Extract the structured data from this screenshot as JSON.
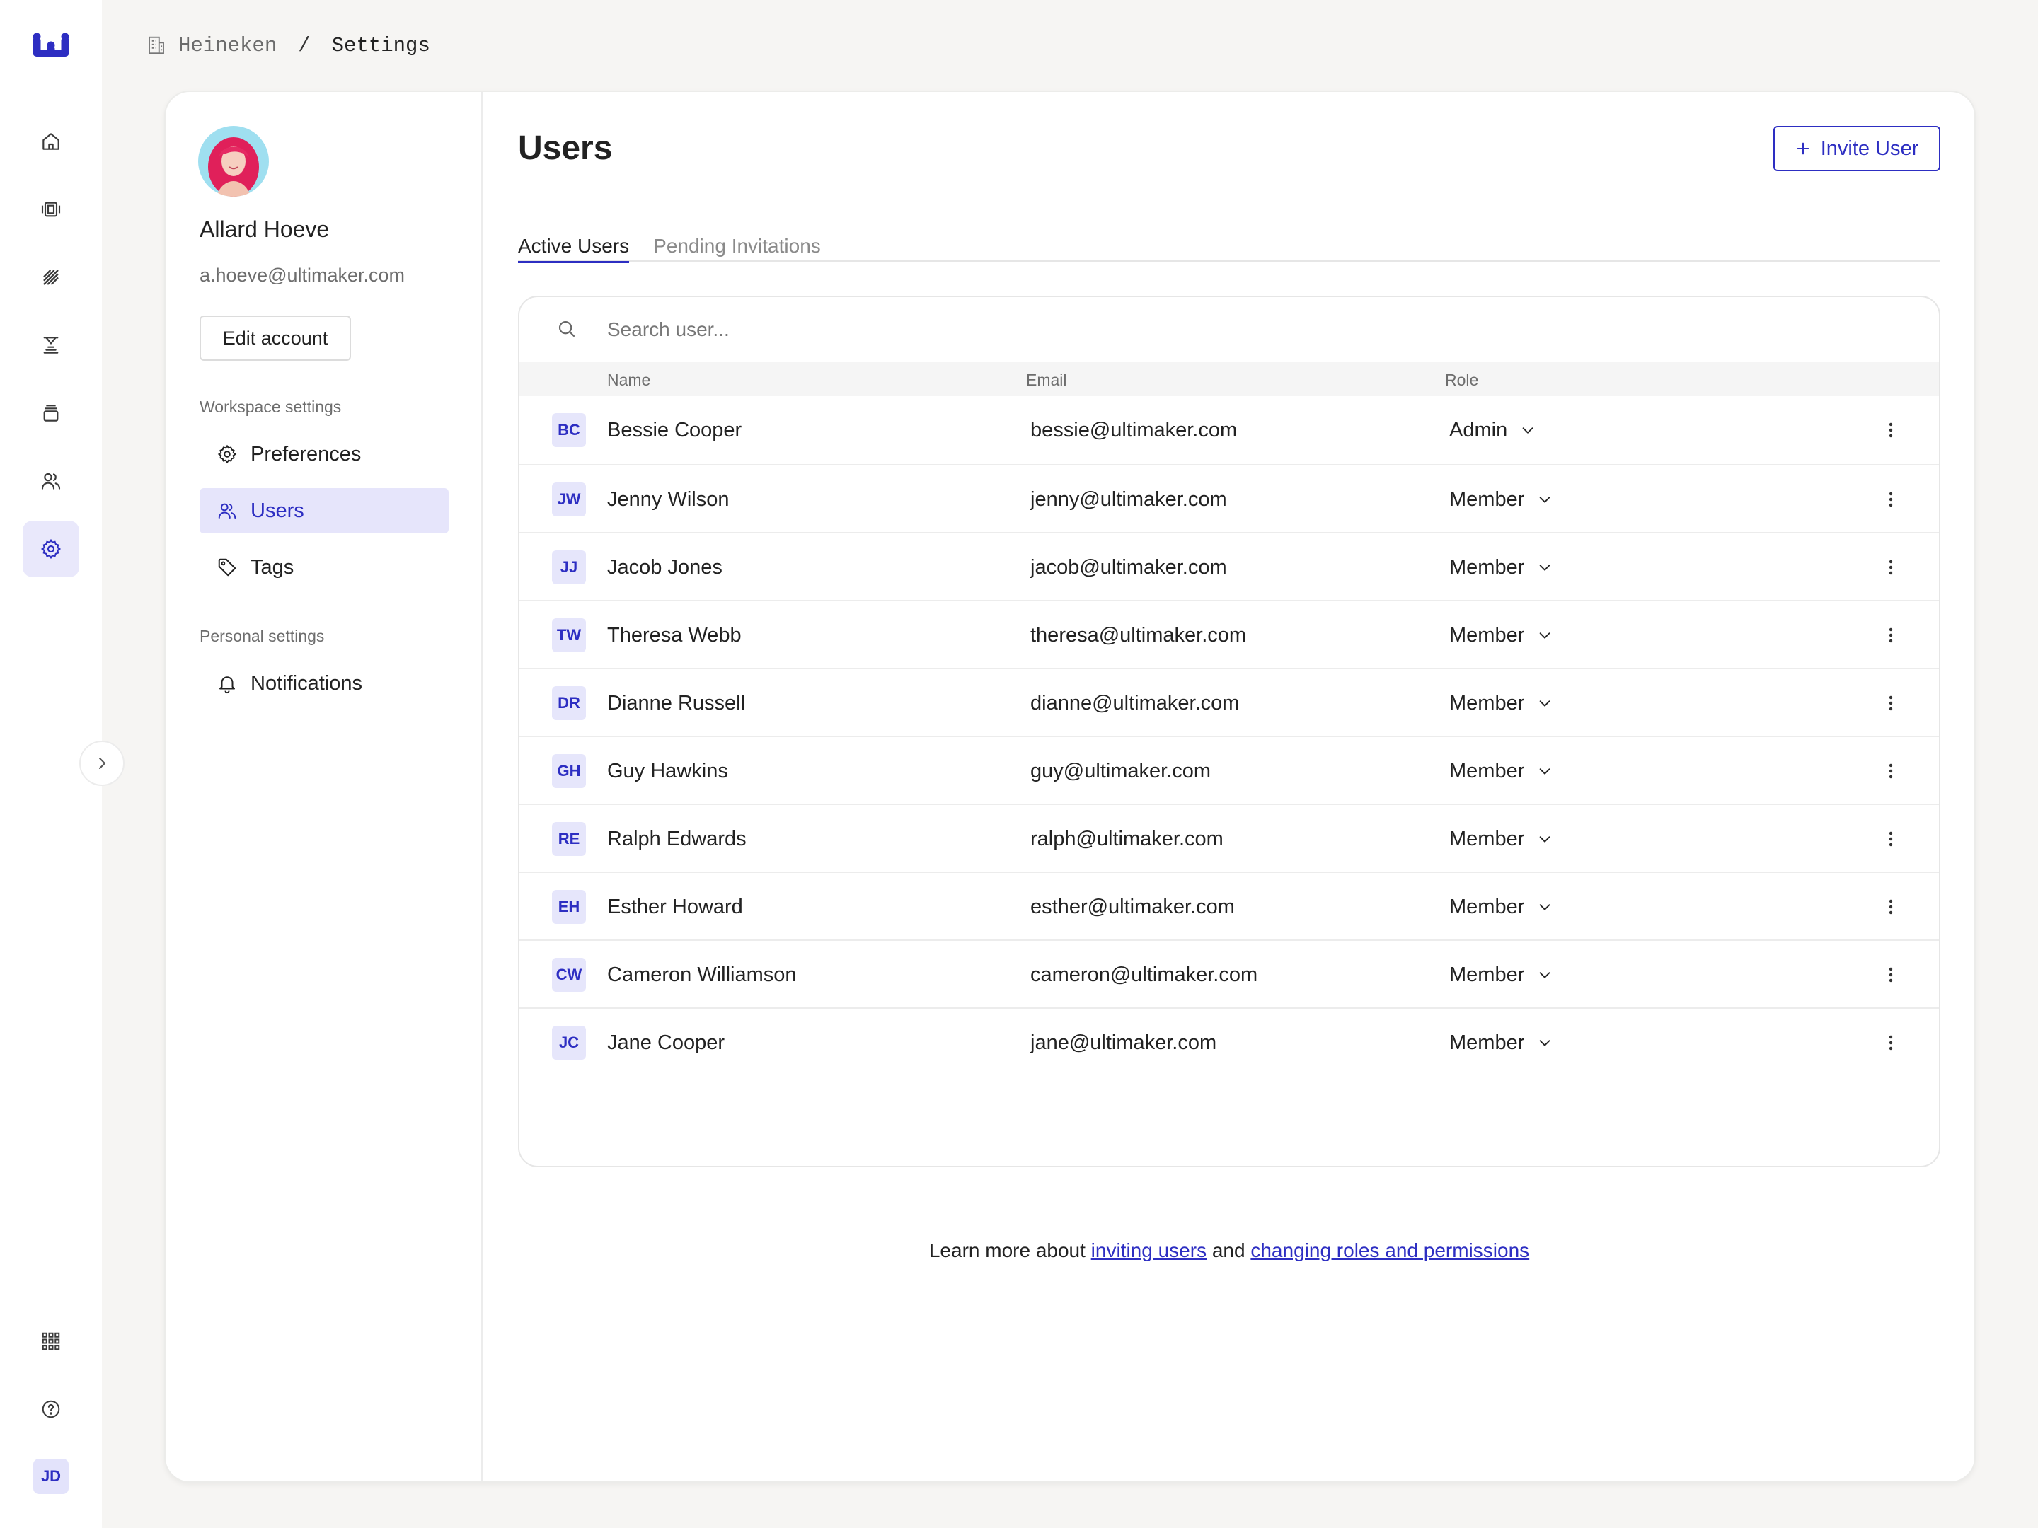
{
  "colors": {
    "accent": "#2d2ec2",
    "accent_soft": "#e6e5fb",
    "background": "#f6f5f3"
  },
  "rail": {
    "icons": [
      "home-icon",
      "layers-icon",
      "stripes-icon",
      "printer-icon",
      "library-icon",
      "people-icon",
      "gear-icon"
    ],
    "bottom_icons": [
      "apps-grid-icon",
      "help-icon"
    ],
    "avatar_initials": "JD"
  },
  "breadcrumb": {
    "org": "Heineken",
    "separator": "/",
    "current": "Settings"
  },
  "profile": {
    "name": "Allard Hoeve",
    "email": "a.hoeve@ultimaker.com",
    "edit_label": "Edit account"
  },
  "settings_nav": {
    "workspace_label": "Workspace settings",
    "workspace_items": [
      {
        "label": "Preferences",
        "icon": "gear-icon"
      },
      {
        "label": "Users",
        "icon": "users-icon"
      },
      {
        "label": "Tags",
        "icon": "tag-icon"
      }
    ],
    "personal_label": "Personal settings",
    "personal_items": [
      {
        "label": "Notifications",
        "icon": "bell-icon"
      }
    ]
  },
  "main": {
    "title": "Users",
    "invite_label": "Invite User",
    "tabs": [
      {
        "label": "Active Users"
      },
      {
        "label": "Pending Invitations"
      }
    ],
    "search": {
      "placeholder": "Search user..."
    },
    "columns": {
      "name": "Name",
      "email": "Email",
      "role": "Role"
    },
    "users": [
      {
        "initials": "BC",
        "name": "Bessie Cooper",
        "email": "bessie@ultimaker.com",
        "role": "Admin"
      },
      {
        "initials": "JW",
        "name": "Jenny Wilson",
        "email": "jenny@ultimaker.com",
        "role": "Member"
      },
      {
        "initials": "JJ",
        "name": "Jacob Jones",
        "email": "jacob@ultimaker.com",
        "role": "Member"
      },
      {
        "initials": "TW",
        "name": "Theresa Webb",
        "email": "theresa@ultimaker.com",
        "role": "Member"
      },
      {
        "initials": "DR",
        "name": "Dianne Russell",
        "email": "dianne@ultimaker.com",
        "role": "Member"
      },
      {
        "initials": "GH",
        "name": "Guy Hawkins",
        "email": "guy@ultimaker.com",
        "role": "Member"
      },
      {
        "initials": "RE",
        "name": "Ralph Edwards",
        "email": "ralph@ultimaker.com",
        "role": "Member"
      },
      {
        "initials": "EH",
        "name": "Esther Howard",
        "email": "esther@ultimaker.com",
        "role": "Member"
      },
      {
        "initials": "CW",
        "name": "Cameron Williamson",
        "email": "cameron@ultimaker.com",
        "role": "Member"
      },
      {
        "initials": "JC",
        "name": "Jane Cooper",
        "email": "jane@ultimaker.com",
        "role": "Member"
      }
    ],
    "footer": {
      "prefix": "Learn more about ",
      "link1": "inviting users",
      "middle": " and ",
      "link2": "changing roles and permissions"
    }
  }
}
